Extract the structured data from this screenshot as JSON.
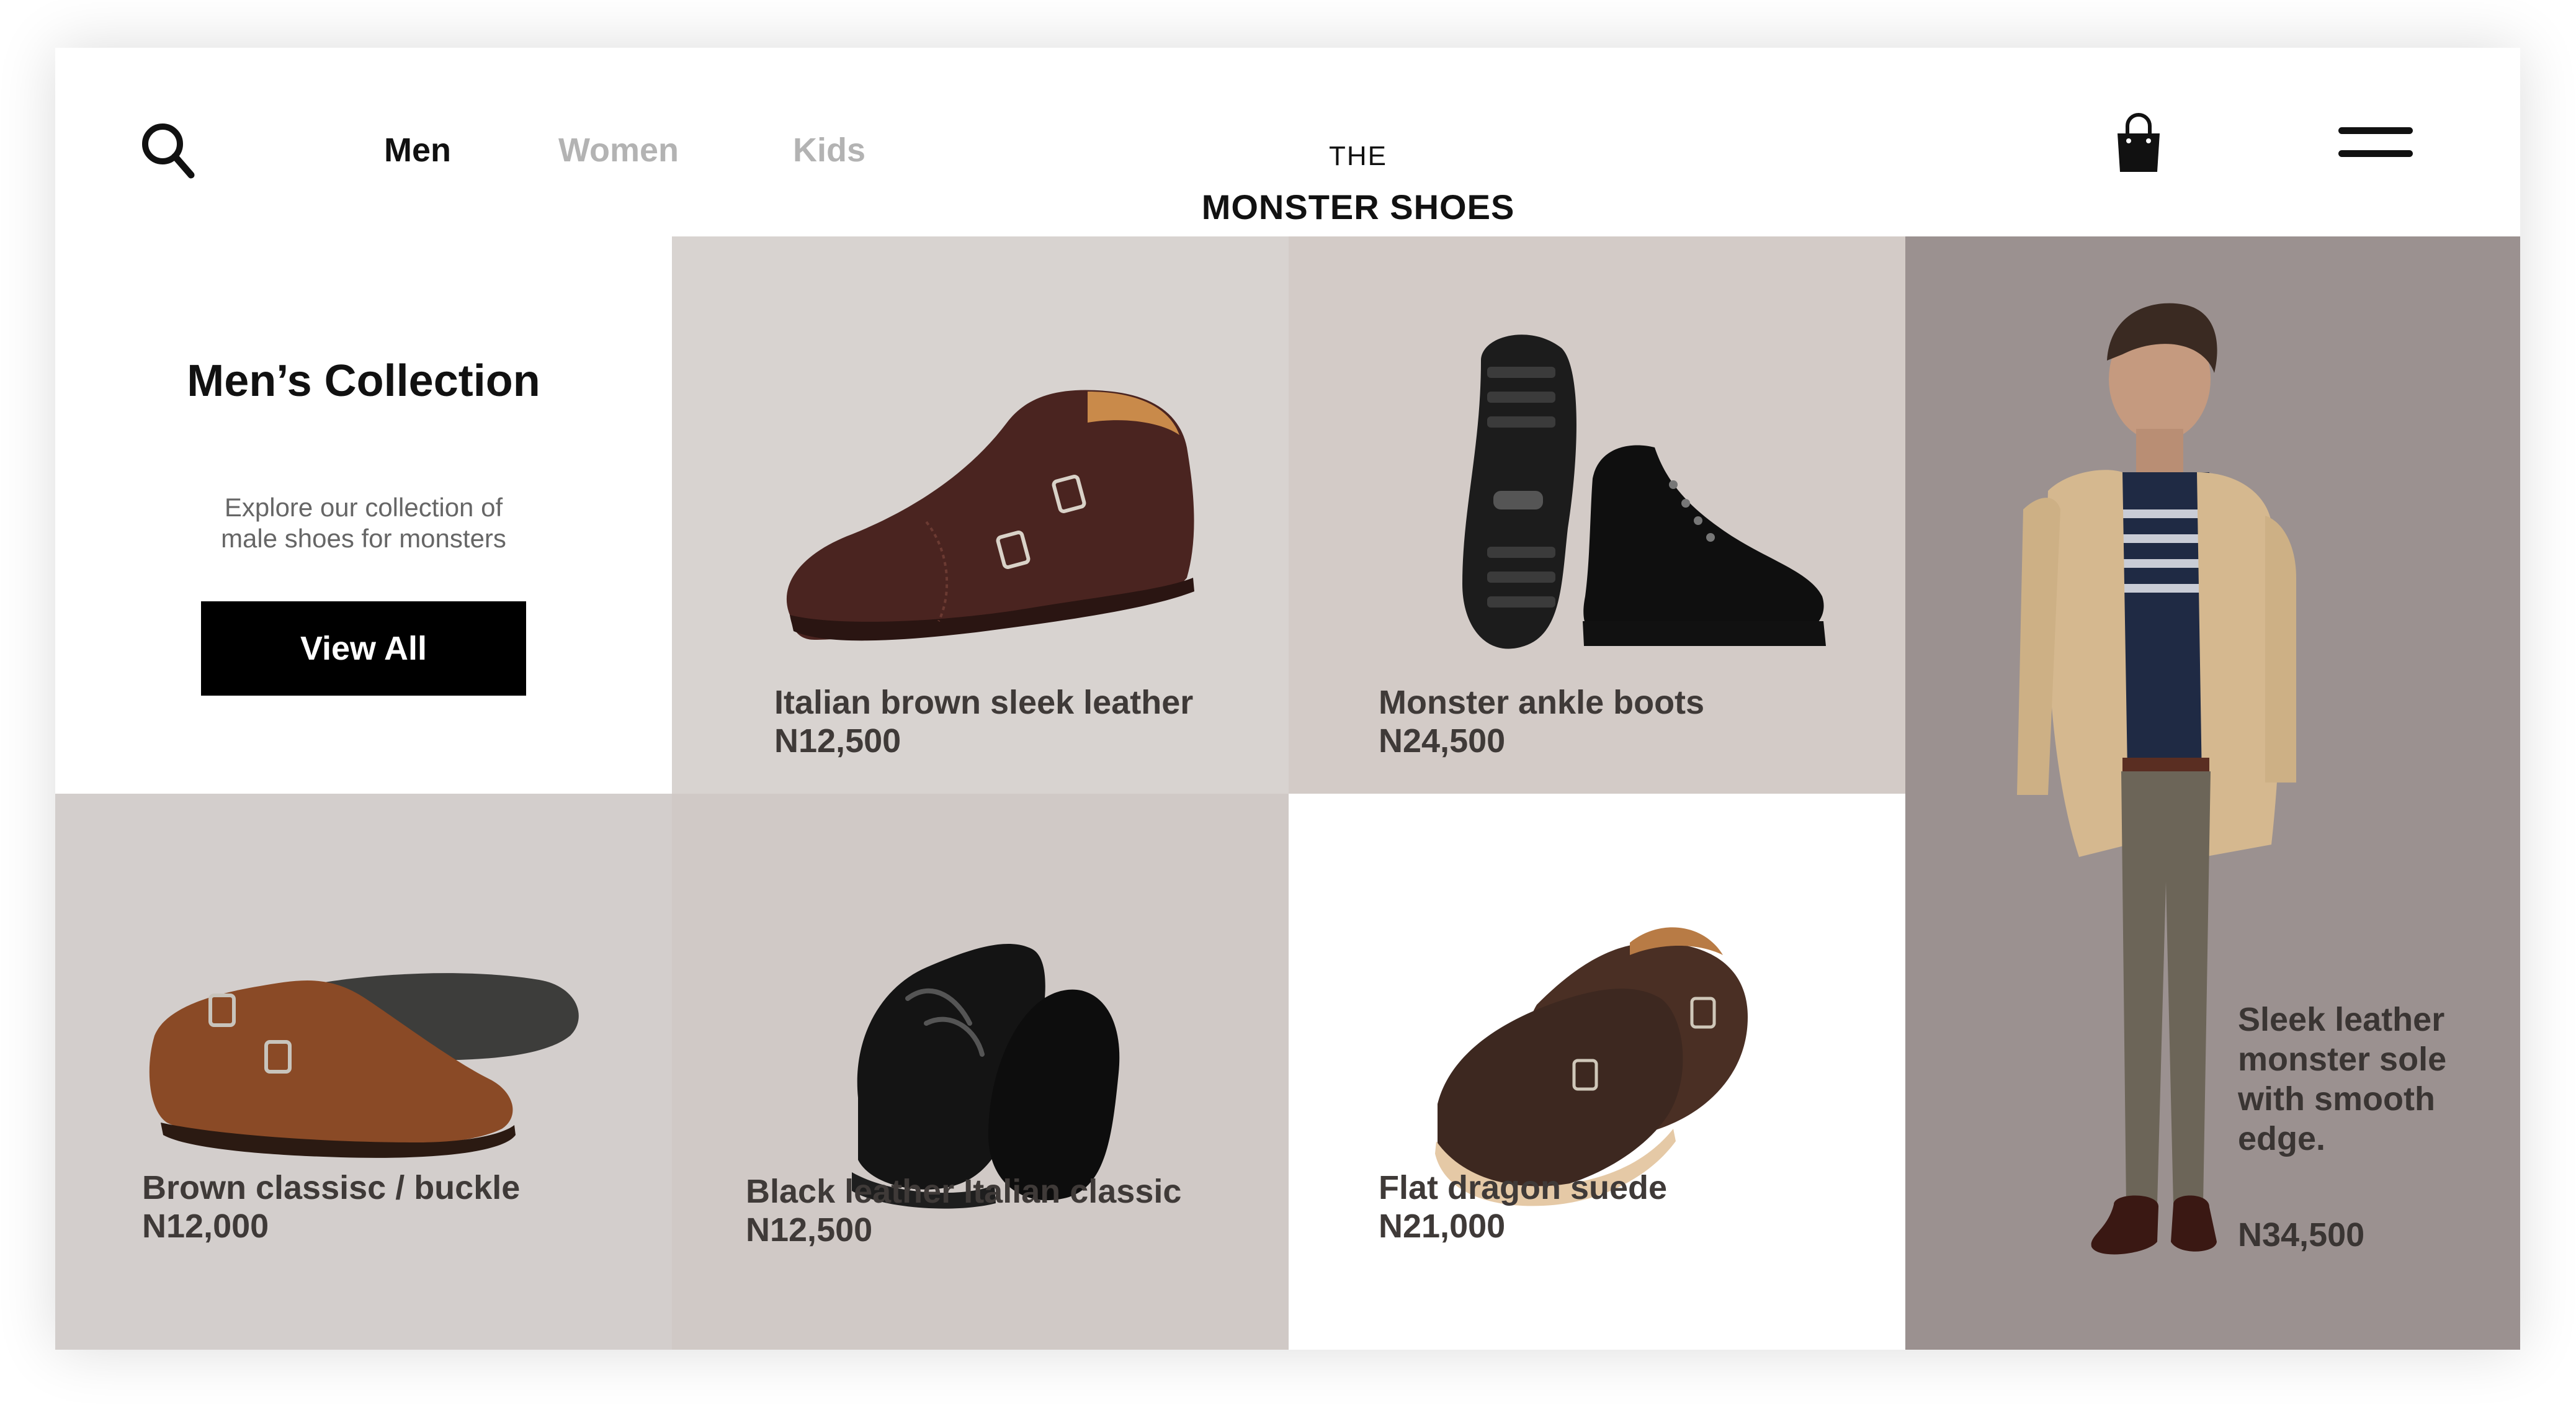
{
  "header": {
    "nav": [
      {
        "label": "Men",
        "active": true
      },
      {
        "label": "Women",
        "active": false
      },
      {
        "label": "Kids",
        "active": false
      }
    ],
    "brand_top": "THE",
    "brand_name": "MONSTER SHOES",
    "icons": [
      "search-icon",
      "shopping-bag-icon",
      "hamburger-menu-icon"
    ]
  },
  "intro": {
    "title": "Men’s Collection",
    "description": "Explore our collection of male shoes for monsters",
    "button": "View All"
  },
  "products": [
    {
      "name": "Italian brown sleek leather",
      "price": "N12,500"
    },
    {
      "name": "Monster ankle boots",
      "price": "N24,500"
    },
    {
      "name": "Brown classisc / buckle",
      "price": "N12,000"
    },
    {
      "name": "Black leather Italian classic",
      "price": "N12,500"
    },
    {
      "name": "Flat dragon suede",
      "price": "N21,000"
    }
  ],
  "featured": {
    "description": "Sleek leather monster sole with smooth edge.",
    "price": "N34,500"
  },
  "colors": {
    "text_dark": "#111111",
    "text_muted": "#b3b3b3",
    "tile_warm_gray": "#d8d3d0",
    "featured_bg": "#9b9190",
    "button_bg": "#000000"
  }
}
